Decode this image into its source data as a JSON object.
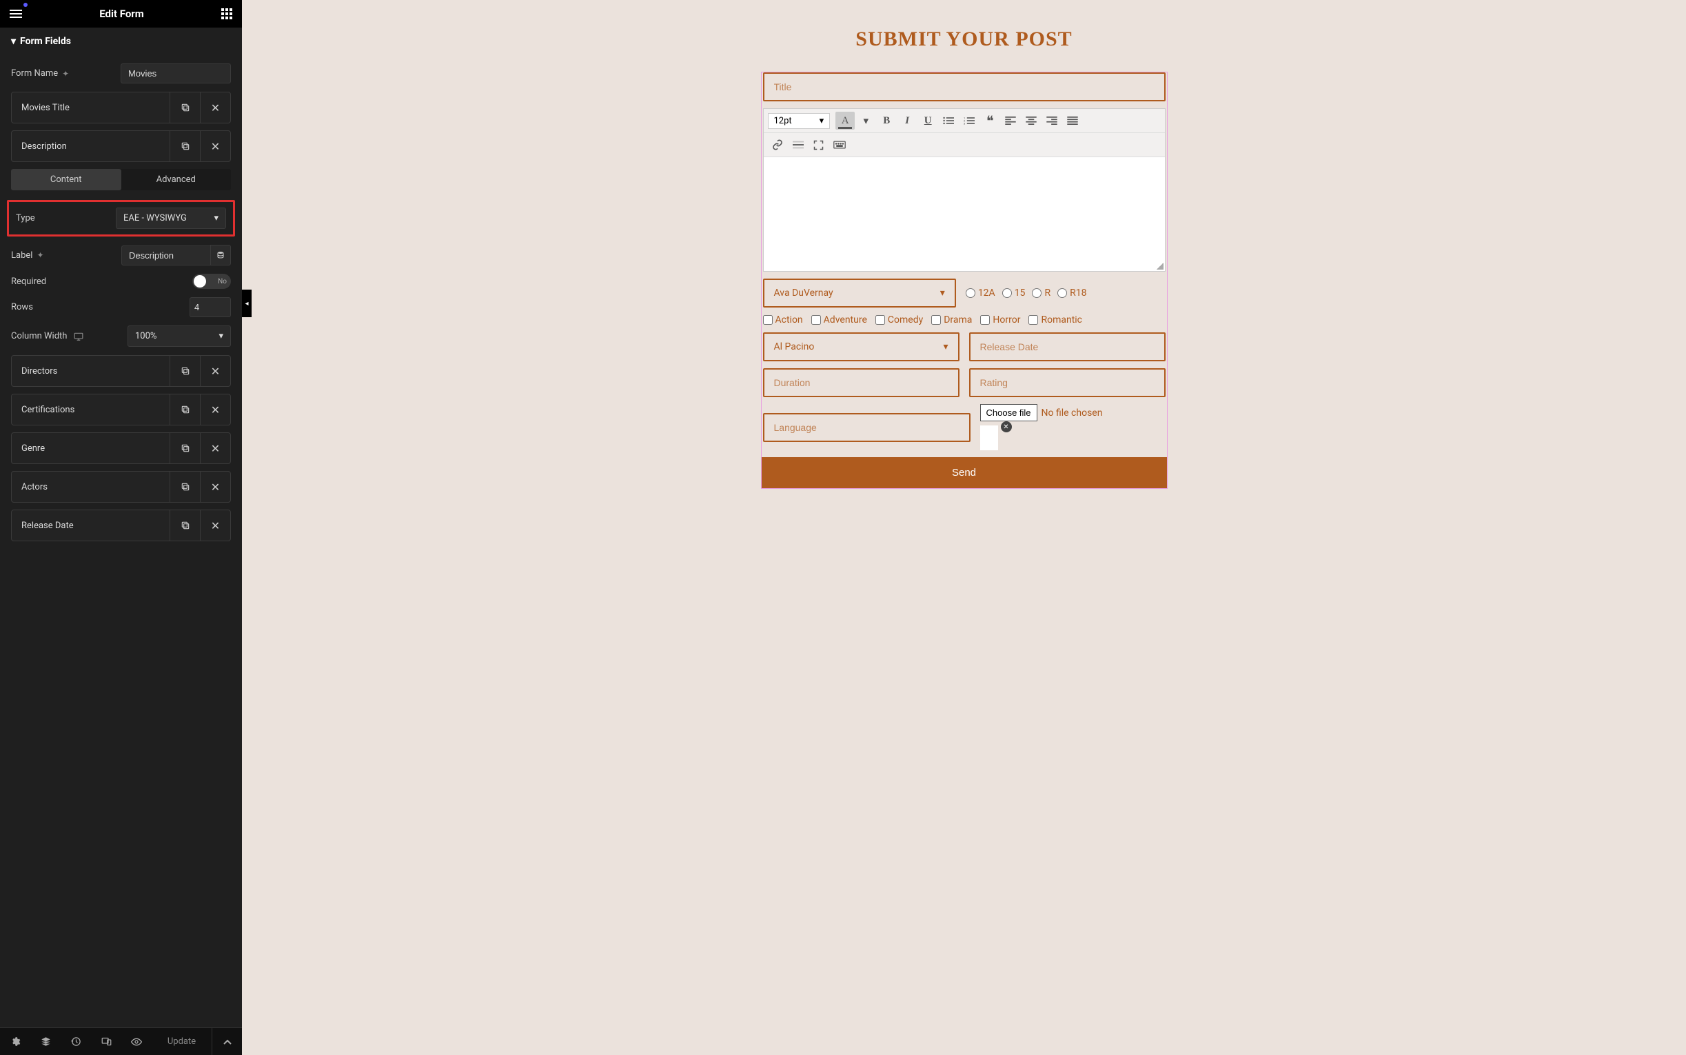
{
  "header": {
    "title": "Edit Form"
  },
  "section": {
    "title": "Form Fields"
  },
  "formName": {
    "label": "Form Name",
    "value": "Movies"
  },
  "fields": [
    {
      "label": "Movies Title"
    },
    {
      "label": "Description"
    },
    {
      "label": "Directors"
    },
    {
      "label": "Certifications"
    },
    {
      "label": "Genre"
    },
    {
      "label": "Actors"
    },
    {
      "label": "Release Date"
    }
  ],
  "subTabs": {
    "content": "Content",
    "advanced": "Advanced"
  },
  "typeRow": {
    "label": "Type",
    "value": "EAE - WYSIWYG"
  },
  "labelRow": {
    "label": "Label",
    "value": "Description"
  },
  "requiredRow": {
    "label": "Required",
    "toggleText": "No"
  },
  "rowsRow": {
    "label": "Rows",
    "value": "4"
  },
  "colWidthRow": {
    "label": "Column Width",
    "value": "100%"
  },
  "bottomBar": {
    "update": "Update"
  },
  "preview": {
    "heading": "SUBMIT YOUR POST",
    "titlePlaceholder": "Title",
    "fontSize": "12pt",
    "directorSelected": "Ava DuVernay",
    "certifications": [
      "12A",
      "15",
      "R",
      "R18"
    ],
    "genres": [
      "Action",
      "Adventure",
      "Comedy",
      "Drama",
      "Horror",
      "Romantic"
    ],
    "actorSelected": "Al Pacino",
    "releaseDatePlaceholder": "Release Date",
    "durationPlaceholder": "Duration",
    "ratingPlaceholder": "Rating",
    "languagePlaceholder": "Language",
    "fileButton": "Choose file",
    "fileStatus": "No file chosen",
    "sendLabel": "Send"
  }
}
